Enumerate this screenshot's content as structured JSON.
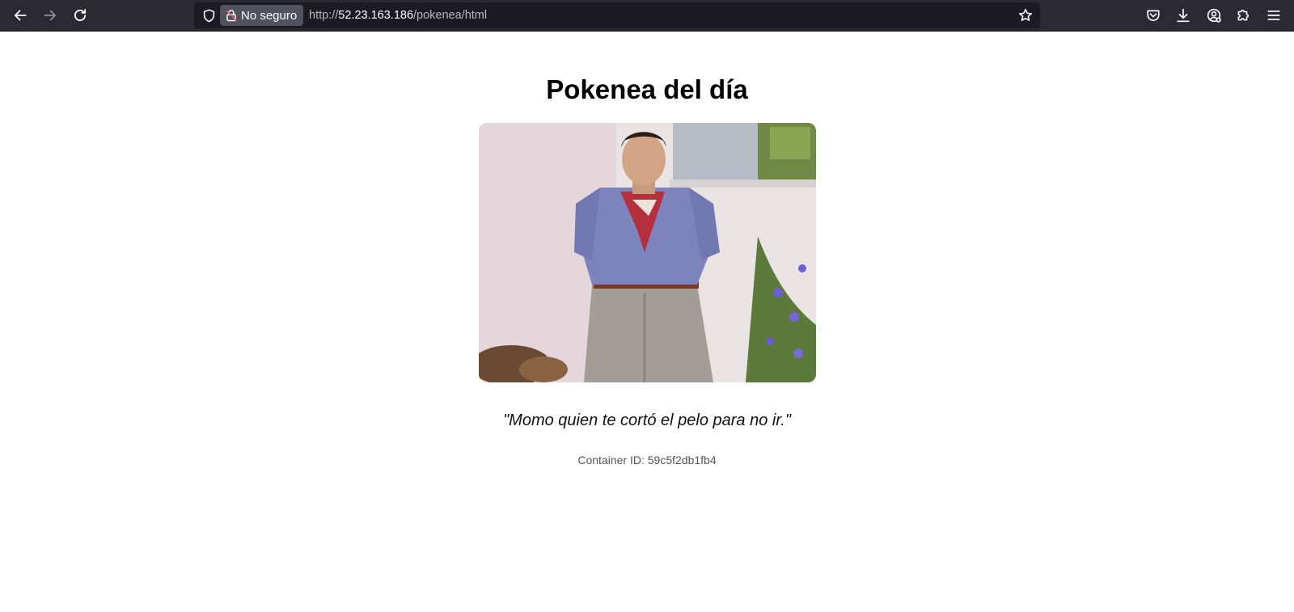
{
  "browser": {
    "security_label": "No seguro",
    "url_prefix": "http://",
    "url_host": "52.23.163.186",
    "url_path": "/pokenea/html",
    "icons": {
      "back": "arrow-left-icon",
      "forward": "arrow-right-icon",
      "reload": "reload-icon",
      "tracking": "shield-icon",
      "insecure": "insecure-lock-icon",
      "bookmark": "star-icon",
      "pocket": "pocket-icon",
      "downloads": "download-icon",
      "account": "account-icon",
      "extensions": "extensions-icon",
      "menu": "hamburger-menu-icon"
    }
  },
  "page": {
    "title": "Pokenea del día",
    "quote": "\"Momo quien te cortó el pelo para no ir.\"",
    "container_id": "Container ID: 59c5f2db1fb4"
  }
}
